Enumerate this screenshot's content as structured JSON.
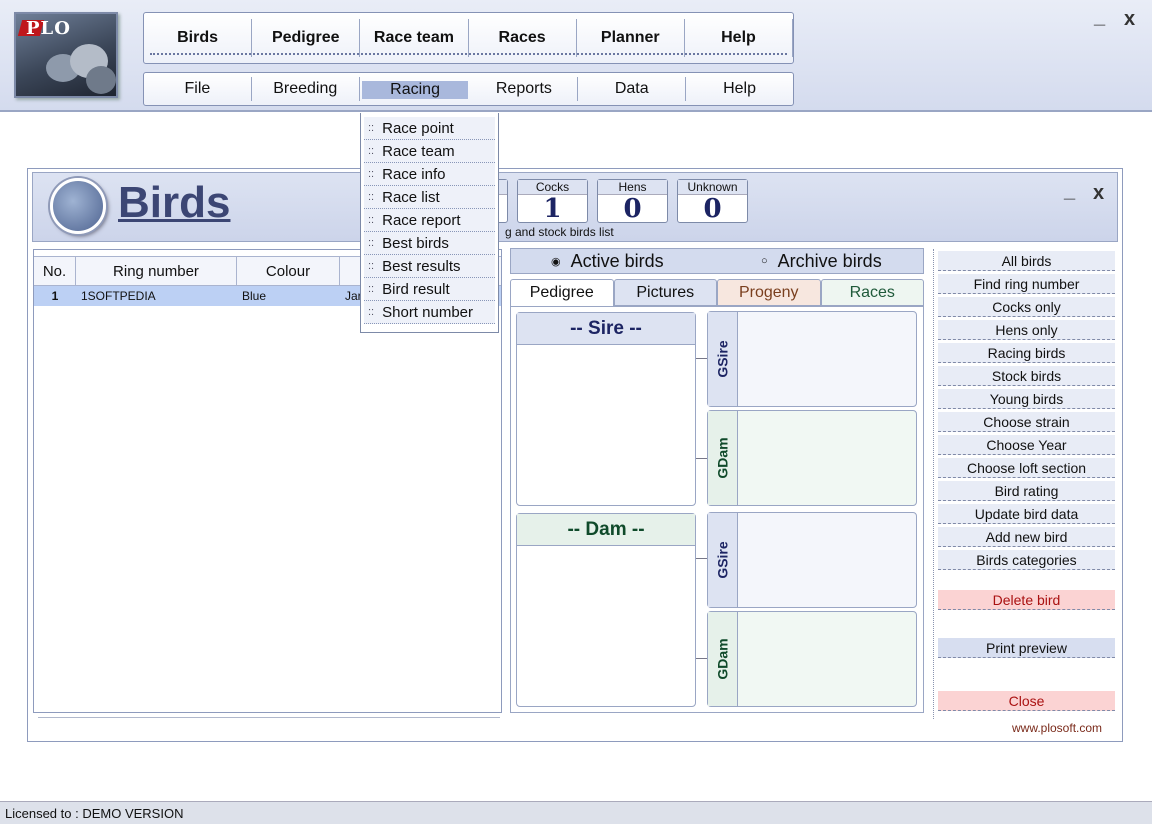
{
  "app": {
    "logo_text": "PLO",
    "window_minimize": "_",
    "window_close": "x"
  },
  "main_menu": {
    "items": [
      {
        "label": "Birds"
      },
      {
        "label": "Pedigree"
      },
      {
        "label": "Race team"
      },
      {
        "label": "Races"
      },
      {
        "label": "Planner"
      },
      {
        "label": "Help"
      }
    ]
  },
  "sub_menu": {
    "items": [
      {
        "label": "File"
      },
      {
        "label": "Breeding"
      },
      {
        "label": "Racing"
      },
      {
        "label": "Reports"
      },
      {
        "label": "Data"
      },
      {
        "label": "Help"
      }
    ],
    "active": "Racing"
  },
  "racing_dropdown": {
    "bullet": "::",
    "items": [
      {
        "label": "Race point"
      },
      {
        "label": "Race team"
      },
      {
        "label": "Race info"
      },
      {
        "label": "Race list"
      },
      {
        "label": "Race report"
      },
      {
        "label": "Best birds"
      },
      {
        "label": "Best results"
      },
      {
        "label": "Bird result"
      },
      {
        "label": "Short number"
      }
    ]
  },
  "birds_window": {
    "title": "Birds",
    "minimize": "_",
    "close": "x",
    "counters": [
      {
        "label": "Cocks",
        "value": "1"
      },
      {
        "label": "Hens",
        "value": "0"
      },
      {
        "label": "Unknown",
        "value": "0"
      }
    ],
    "header_note": "g and stock birds list",
    "table": {
      "columns": [
        "No.",
        "Ring number",
        "Colour",
        ""
      ],
      "rows": [
        {
          "no": "1",
          "ring": "1SOFTPEDIA",
          "colour": "Blue",
          "extra": "Jar"
        }
      ]
    },
    "filter": {
      "active_label": "Active birds",
      "archive_label": "Archive birds",
      "active_marker": "◉",
      "archive_marker": "○"
    },
    "tabs": [
      {
        "label": "Pedigree"
      },
      {
        "label": "Pictures"
      },
      {
        "label": "Progeny"
      },
      {
        "label": "Races"
      }
    ],
    "pedigree": {
      "sire_label": "-- Sire --",
      "dam_label": "-- Dam --",
      "gsire_label": "GSire",
      "gdam_label": "GDam"
    },
    "side_buttons": [
      {
        "label": "All birds"
      },
      {
        "label": "Find ring number"
      },
      {
        "label": "Cocks only"
      },
      {
        "label": "Hens only"
      },
      {
        "label": "Racing birds"
      },
      {
        "label": "Stock birds"
      },
      {
        "label": "Young birds"
      },
      {
        "label": "Choose strain"
      },
      {
        "label": "Choose Year"
      },
      {
        "label": "Choose loft section"
      },
      {
        "label": "Bird rating"
      },
      {
        "label": "Update bird data"
      },
      {
        "label": "Add new bird"
      },
      {
        "label": "Birds categories"
      }
    ],
    "delete_label": "Delete bird",
    "print_label": "Print preview",
    "close_label": "Close",
    "website": "www.plosoft.com"
  },
  "status": {
    "license": "Licensed to : DEMO VERSION"
  },
  "colors": {
    "accent": "#3c4674",
    "menu_active": "#a9b8dc",
    "selected_row": "#bcd0f4",
    "danger": "#fbd3d3",
    "sire": "#1c2463",
    "dam": "#0f4a2a"
  }
}
